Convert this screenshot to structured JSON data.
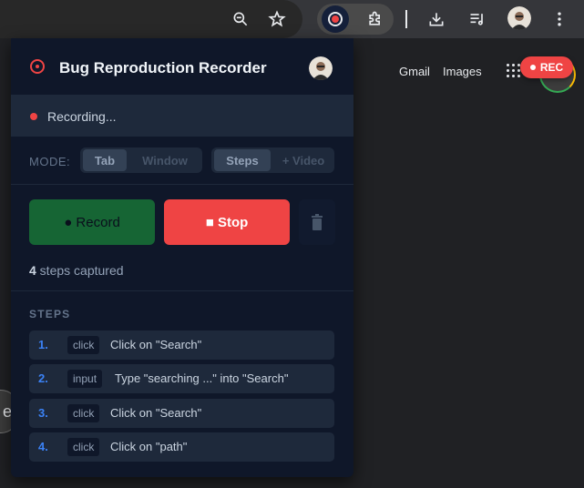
{
  "browser": {
    "toolbar_icons": [
      "zoom-icon",
      "bookmark-star-icon",
      "extension-recorder-icon",
      "extensions-puzzle-icon",
      "download-icon",
      "media-playlist-icon",
      "profile-avatar",
      "kebab-menu-icon"
    ]
  },
  "page": {
    "gmail_link": "Gmail",
    "images_link": "Images",
    "left_bubble_char": "e"
  },
  "rec_badge": {
    "label": "REC",
    "color": "#ef4444"
  },
  "popup": {
    "title": "Bug Reproduction Recorder",
    "status_text": "Recording...",
    "mode": {
      "label": "MODE:",
      "capture_options": [
        "Tab",
        "Window"
      ],
      "capture_selected": "Tab",
      "output_options": [
        "Steps",
        "+ Video"
      ],
      "output_selected": "Steps"
    },
    "buttons": {
      "record_label": "● Record",
      "stop_label": "■ Stop"
    },
    "steps_captured": {
      "count": "4",
      "suffix": " steps captured"
    },
    "steps_title": "STEPS",
    "steps": [
      {
        "num": "1.",
        "type": "click",
        "desc": "Click on \"Search\""
      },
      {
        "num": "2.",
        "type": "input",
        "desc": "Type \"searching ...\" into \"Search\""
      },
      {
        "num": "3.",
        "type": "click",
        "desc": "Click on \"Search\""
      },
      {
        "num": "4.",
        "type": "click",
        "desc": "Click on \"path\""
      }
    ]
  },
  "colors": {
    "accent_red": "#ef4444",
    "record_green": "#166534",
    "step_number_blue": "#3b82f6",
    "popup_bg": "#0f1729"
  }
}
